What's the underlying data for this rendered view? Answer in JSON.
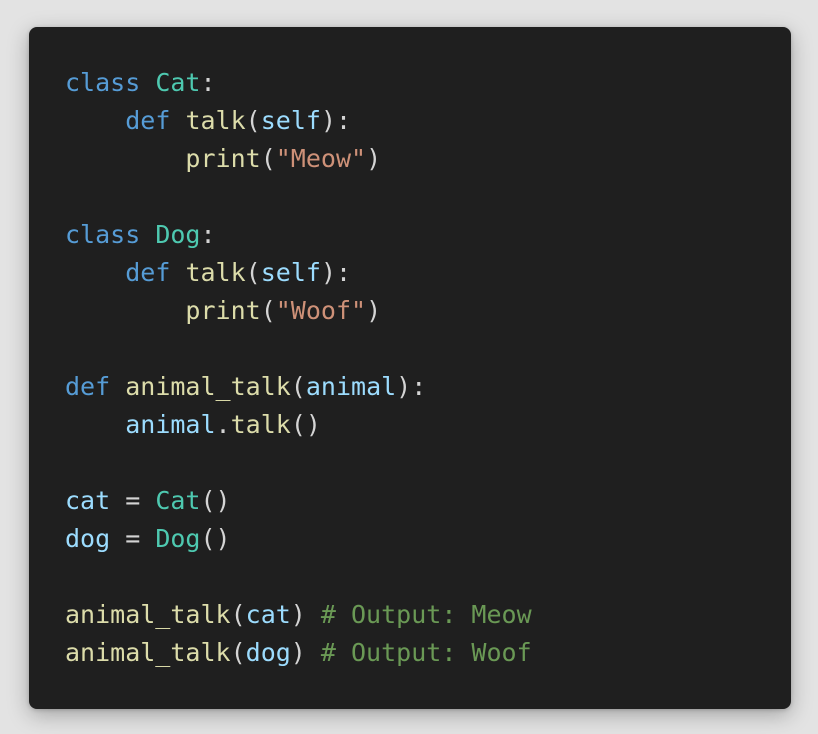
{
  "colors": {
    "background": "#e3e3e3",
    "editor_background": "#1f1f1f",
    "keyword": "#569cd6",
    "class_name": "#4ec9b0",
    "function_name": "#dcdcaa",
    "variable": "#9cdcfe",
    "string": "#ce9178",
    "comment": "#6a9955",
    "punctuation": "#d4d4d4"
  },
  "code": {
    "language": "python",
    "lines": [
      [
        {
          "t": "kw",
          "v": "class"
        },
        {
          "t": "pn",
          "v": " "
        },
        {
          "t": "cls",
          "v": "Cat"
        },
        {
          "t": "pn",
          "v": ":"
        }
      ],
      [
        {
          "t": "pn",
          "v": "    "
        },
        {
          "t": "kw",
          "v": "def"
        },
        {
          "t": "pn",
          "v": " "
        },
        {
          "t": "fn",
          "v": "talk"
        },
        {
          "t": "pn",
          "v": "("
        },
        {
          "t": "var",
          "v": "self"
        },
        {
          "t": "pn",
          "v": "):"
        }
      ],
      [
        {
          "t": "pn",
          "v": "        "
        },
        {
          "t": "fn",
          "v": "print"
        },
        {
          "t": "pn",
          "v": "("
        },
        {
          "t": "str",
          "v": "\"Meow\""
        },
        {
          "t": "pn",
          "v": ")"
        }
      ],
      [],
      [
        {
          "t": "kw",
          "v": "class"
        },
        {
          "t": "pn",
          "v": " "
        },
        {
          "t": "cls",
          "v": "Dog"
        },
        {
          "t": "pn",
          "v": ":"
        }
      ],
      [
        {
          "t": "pn",
          "v": "    "
        },
        {
          "t": "kw",
          "v": "def"
        },
        {
          "t": "pn",
          "v": " "
        },
        {
          "t": "fn",
          "v": "talk"
        },
        {
          "t": "pn",
          "v": "("
        },
        {
          "t": "var",
          "v": "self"
        },
        {
          "t": "pn",
          "v": "):"
        }
      ],
      [
        {
          "t": "pn",
          "v": "        "
        },
        {
          "t": "fn",
          "v": "print"
        },
        {
          "t": "pn",
          "v": "("
        },
        {
          "t": "str",
          "v": "\"Woof\""
        },
        {
          "t": "pn",
          "v": ")"
        }
      ],
      [],
      [
        {
          "t": "kw",
          "v": "def"
        },
        {
          "t": "pn",
          "v": " "
        },
        {
          "t": "fn",
          "v": "animal_talk"
        },
        {
          "t": "pn",
          "v": "("
        },
        {
          "t": "var",
          "v": "animal"
        },
        {
          "t": "pn",
          "v": "):"
        }
      ],
      [
        {
          "t": "pn",
          "v": "    "
        },
        {
          "t": "var",
          "v": "animal"
        },
        {
          "t": "pn",
          "v": "."
        },
        {
          "t": "fn",
          "v": "talk"
        },
        {
          "t": "pn",
          "v": "()"
        }
      ],
      [],
      [
        {
          "t": "var",
          "v": "cat"
        },
        {
          "t": "pn",
          "v": " = "
        },
        {
          "t": "cls",
          "v": "Cat"
        },
        {
          "t": "pn",
          "v": "()"
        }
      ],
      [
        {
          "t": "var",
          "v": "dog"
        },
        {
          "t": "pn",
          "v": " = "
        },
        {
          "t": "cls",
          "v": "Dog"
        },
        {
          "t": "pn",
          "v": "()"
        }
      ],
      [],
      [
        {
          "t": "fn",
          "v": "animal_talk"
        },
        {
          "t": "pn",
          "v": "("
        },
        {
          "t": "var",
          "v": "cat"
        },
        {
          "t": "pn",
          "v": ") "
        },
        {
          "t": "cm",
          "v": "# Output: Meow"
        }
      ],
      [
        {
          "t": "fn",
          "v": "animal_talk"
        },
        {
          "t": "pn",
          "v": "("
        },
        {
          "t": "var",
          "v": "dog"
        },
        {
          "t": "pn",
          "v": ") "
        },
        {
          "t": "cm",
          "v": "# Output: Woof"
        }
      ]
    ]
  }
}
